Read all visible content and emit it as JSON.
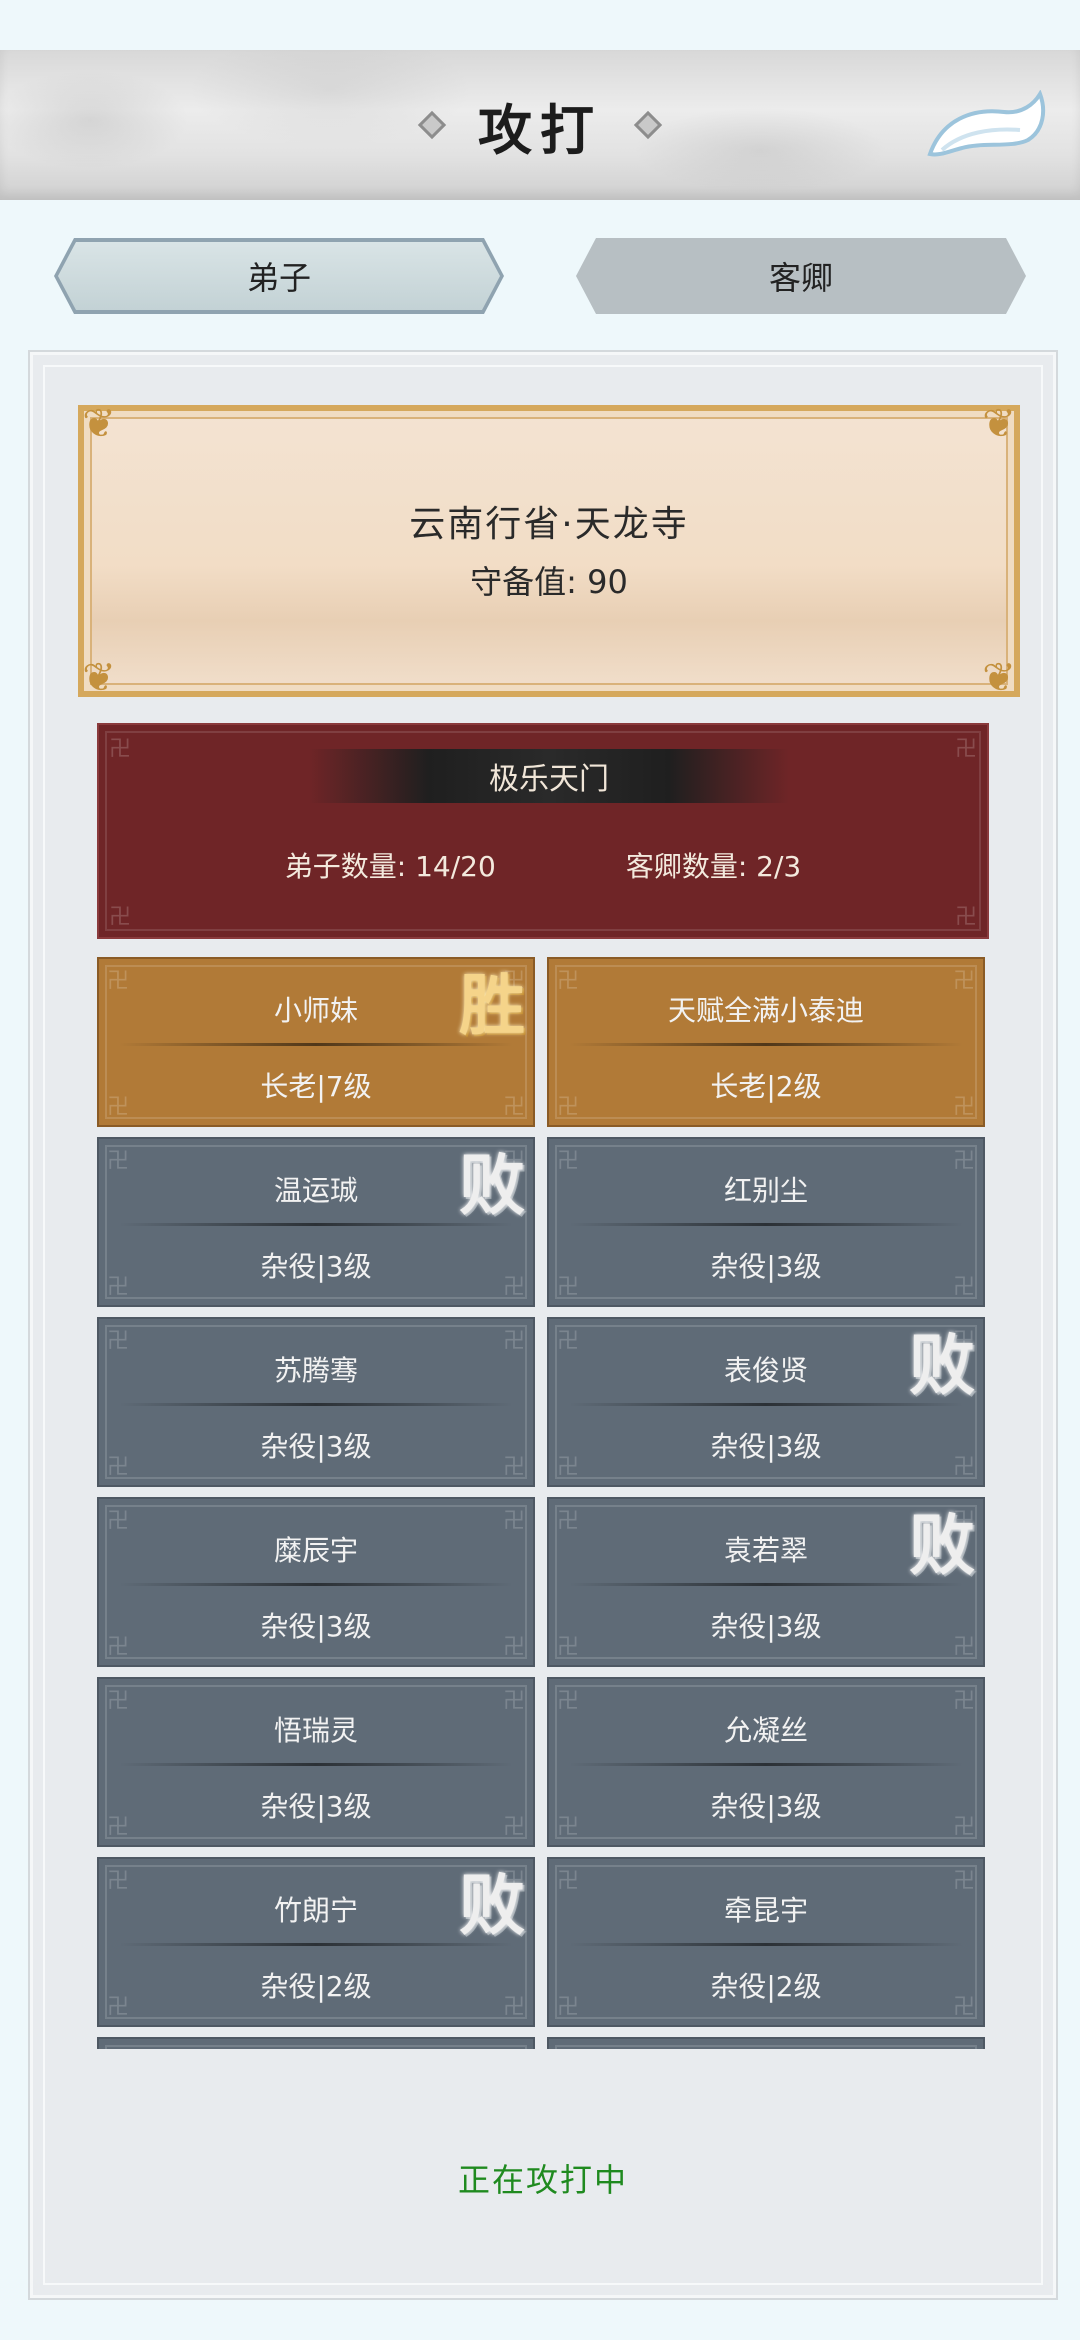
{
  "header": {
    "title": "攻打",
    "back_icon": "back-arrow-icon"
  },
  "tabs": [
    {
      "label": "弟子",
      "active": true
    },
    {
      "label": "客卿",
      "active": false
    }
  ],
  "location": {
    "name": "云南行省·天龙寺",
    "defense": "守备值: 90"
  },
  "sect": {
    "name": "极乐天门",
    "disciples": "弟子数量: 14/20",
    "guests": "客卿数量: 2/3"
  },
  "members": [
    {
      "name": "小师妹",
      "rank": "长老|7级",
      "badge": "胜",
      "style": "gold"
    },
    {
      "name": "天赋全满小泰迪",
      "rank": "长老|2级",
      "badge": "",
      "style": "gold"
    },
    {
      "name": "温运珹",
      "rank": "杂役|3级",
      "badge": "败",
      "style": "gray"
    },
    {
      "name": "红别尘",
      "rank": "杂役|3级",
      "badge": "",
      "style": "gray"
    },
    {
      "name": "苏腾骞",
      "rank": "杂役|3级",
      "badge": "",
      "style": "gray"
    },
    {
      "name": "表俊贤",
      "rank": "杂役|3级",
      "badge": "败",
      "style": "gray"
    },
    {
      "name": "糜辰宇",
      "rank": "杂役|3级",
      "badge": "",
      "style": "gray"
    },
    {
      "name": "袁若翠",
      "rank": "杂役|3级",
      "badge": "败",
      "style": "gray"
    },
    {
      "name": "悟瑞灵",
      "rank": "杂役|3级",
      "badge": "",
      "style": "gray"
    },
    {
      "name": "允凝丝",
      "rank": "杂役|3级",
      "badge": "",
      "style": "gray"
    },
    {
      "name": "竹朗宁",
      "rank": "杂役|2级",
      "badge": "败",
      "style": "gray"
    },
    {
      "name": "牵昆宇",
      "rank": "杂役|2级",
      "badge": "",
      "style": "gray"
    },
    {
      "name": "",
      "rank": "",
      "badge": "",
      "style": "gray"
    },
    {
      "name": "",
      "rank": "",
      "badge": "",
      "style": "gray"
    }
  ],
  "status": "正在攻打中"
}
